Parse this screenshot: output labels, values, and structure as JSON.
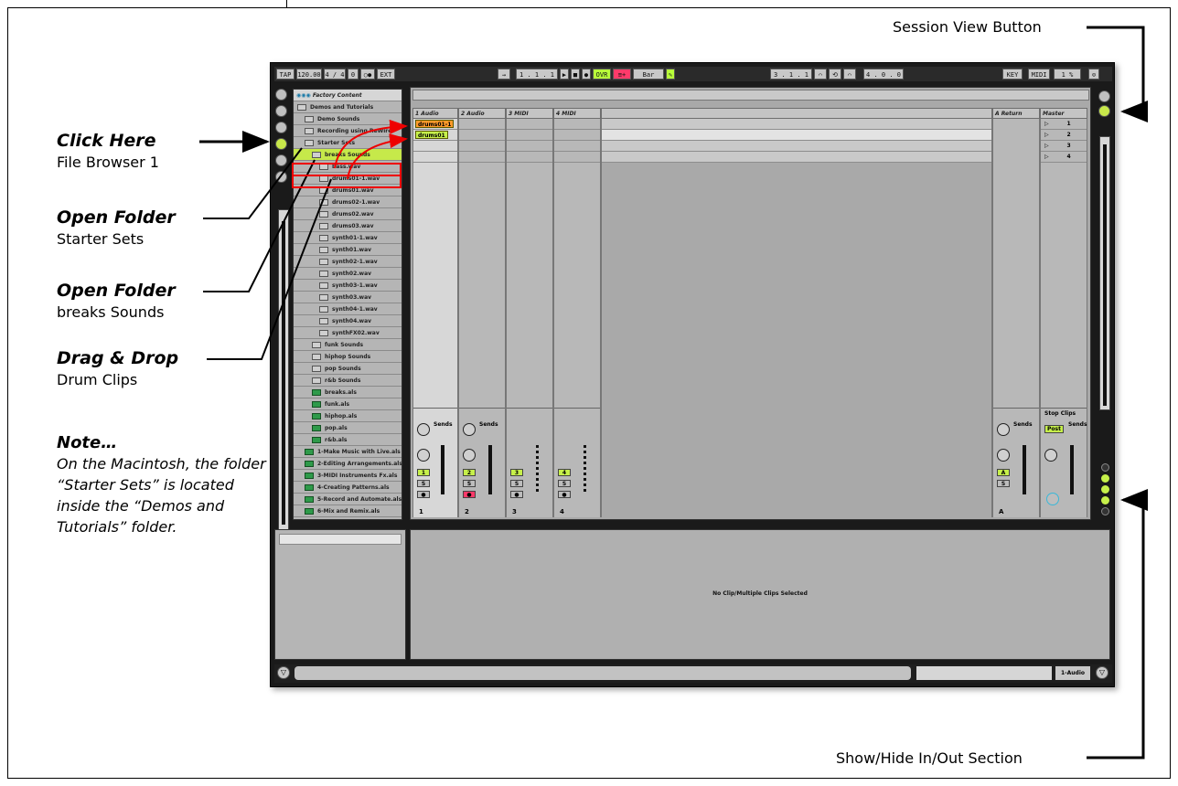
{
  "annotations": {
    "session_view_button": "Session View Button",
    "show_hide_io": "Show/Hide In/Out Section",
    "click_here": {
      "head": "Click Here",
      "sub": "File Browser 1"
    },
    "open_folder_1": {
      "head": "Open Folder",
      "sub": "Starter Sets"
    },
    "open_folder_2": {
      "head": "Open Folder",
      "sub": "breaks Sounds"
    },
    "drag_drop": {
      "head": "Drag & Drop",
      "sub": "Drum Clips"
    },
    "note": {
      "head": "Note…",
      "body": "On the Macintosh, the folder “Starter Sets” is located inside the “Demos and Tutorials” folder."
    }
  },
  "transport": {
    "tap": "TAP",
    "tempo": "120.00",
    "signature": "4 / 4",
    "quant": "0",
    "ext": "EXT",
    "position": "1 . 1 . 1",
    "ovr": "OVR",
    "bar": "Bar",
    "loop_start": "3 . 1 . 1",
    "loop_length": "4 . 0 . 0",
    "key": "KEY",
    "midi": "MIDI",
    "cpu": "1 %"
  },
  "browser": {
    "header": "Factory Content",
    "items": [
      {
        "label": "Demos and Tutorials",
        "type": "folder",
        "indent": 0
      },
      {
        "label": "Demo Sounds",
        "type": "folder",
        "indent": 1
      },
      {
        "label": "Recording using ReWire",
        "type": "folder",
        "indent": 1
      },
      {
        "label": "Starter Sets",
        "type": "folder",
        "indent": 1
      },
      {
        "label": "breaks Sounds",
        "type": "folder",
        "indent": 2,
        "selected": true
      },
      {
        "label": "bass.wav",
        "type": "file",
        "indent": 3
      },
      {
        "label": "drums01-1.wav",
        "type": "file",
        "indent": 3
      },
      {
        "label": "drums01.wav",
        "type": "file",
        "indent": 3
      },
      {
        "label": "drums02-1.wav",
        "type": "file",
        "indent": 3
      },
      {
        "label": "drums02.wav",
        "type": "file",
        "indent": 3
      },
      {
        "label": "drums03.wav",
        "type": "file",
        "indent": 3
      },
      {
        "label": "synth01-1.wav",
        "type": "file",
        "indent": 3
      },
      {
        "label": "synth01.wav",
        "type": "file",
        "indent": 3
      },
      {
        "label": "synth02-1.wav",
        "type": "file",
        "indent": 3
      },
      {
        "label": "synth02.wav",
        "type": "file",
        "indent": 3
      },
      {
        "label": "synth03-1.wav",
        "type": "file",
        "indent": 3
      },
      {
        "label": "synth03.wav",
        "type": "file",
        "indent": 3
      },
      {
        "label": "synth04-1.wav",
        "type": "file",
        "indent": 3
      },
      {
        "label": "synth04.wav",
        "type": "file",
        "indent": 3
      },
      {
        "label": "synthFX02.wav",
        "type": "file",
        "indent": 3
      },
      {
        "label": "funk Sounds",
        "type": "folder",
        "indent": 2
      },
      {
        "label": "hiphop Sounds",
        "type": "folder",
        "indent": 2
      },
      {
        "label": "pop Sounds",
        "type": "folder",
        "indent": 2
      },
      {
        "label": "r&b Sounds",
        "type": "folder",
        "indent": 2
      },
      {
        "label": "breaks.als",
        "type": "set",
        "indent": 2
      },
      {
        "label": "funk.als",
        "type": "set",
        "indent": 2
      },
      {
        "label": "hiphop.als",
        "type": "set",
        "indent": 2
      },
      {
        "label": "pop.als",
        "type": "set",
        "indent": 2
      },
      {
        "label": "r&b.als",
        "type": "set",
        "indent": 2
      },
      {
        "label": "1-Make Music with Live.als",
        "type": "set",
        "indent": 1
      },
      {
        "label": "2-Editing Arrangements.als",
        "type": "set",
        "indent": 1
      },
      {
        "label": "3-MIDI Instruments Fx.als",
        "type": "set",
        "indent": 1
      },
      {
        "label": "4-Creating Patterns.als",
        "type": "set",
        "indent": 1
      },
      {
        "label": "5-Record and Automate.als",
        "type": "set",
        "indent": 1
      },
      {
        "label": "6-Mix and Remix.als",
        "type": "set",
        "indent": 1
      }
    ]
  },
  "tracks": [
    {
      "name": "1 Audio",
      "number": "1"
    },
    {
      "name": "2 Audio",
      "number": "2"
    },
    {
      "name": "3 MIDI",
      "number": "3"
    },
    {
      "name": "4 MIDI",
      "number": "4"
    }
  ],
  "clips": {
    "clip1": "drums01-1",
    "clip2": "drums01"
  },
  "return_track": {
    "name": "A Return",
    "letter": "A"
  },
  "master": {
    "name": "Master",
    "scenes": [
      "1",
      "2",
      "3",
      "4"
    ],
    "stop_clips": "Stop Clips",
    "post": "Post"
  },
  "mixer": {
    "sends": "Sends"
  },
  "detail": {
    "message": "No Clip/Multiple Clips Selected"
  },
  "statusbar": {
    "track_label": "1-Audio"
  }
}
